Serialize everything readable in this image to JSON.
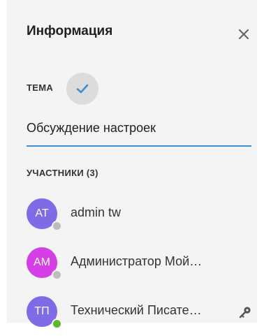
{
  "panel": {
    "title": "Информация",
    "close_icon": "close-icon"
  },
  "topic": {
    "label": "ТЕМА",
    "confirm_icon": "check-icon",
    "value": "Обсуждение настроек"
  },
  "participants": {
    "label": "УЧАСТНИКИ (3)",
    "members": [
      {
        "initials": "AT",
        "name": "admin tw",
        "avatar_color": "#7f6be6",
        "status": "offline",
        "status_color": "#bdbdbd",
        "owner": false
      },
      {
        "initials": "AM",
        "name": "Администратор Мой…",
        "avatar_color": "#d63fe6",
        "status": "offline",
        "status_color": "#bdbdbd",
        "owner": false
      },
      {
        "initials": "ТП",
        "name": "Технический Писате…",
        "avatar_color": "#7f6be6",
        "status": "online",
        "status_color": "#5cb82e",
        "owner": true,
        "owner_icon": "key-icon"
      }
    ]
  },
  "colors": {
    "accent": "#3a8fd6",
    "panel_background": "#f4f4f4"
  }
}
